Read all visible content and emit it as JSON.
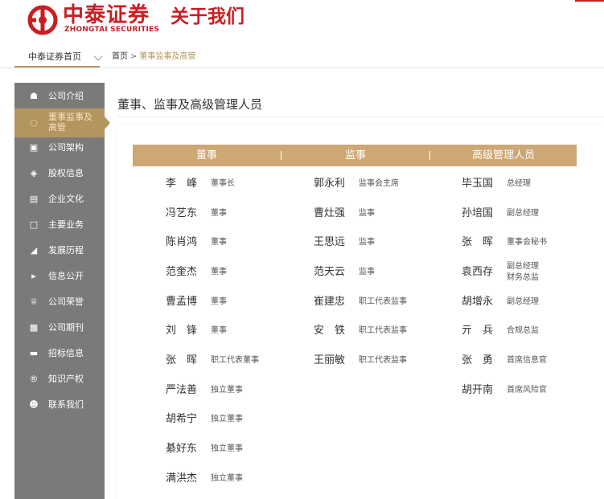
{
  "brand": {
    "name_cn": "中泰证券",
    "name_en": "ZHONGTAI SECURITIES",
    "color": "#c81e24"
  },
  "page_heading": "关于我们",
  "nav": {
    "home_label": "中泰证券首页",
    "breadcrumb": [
      "首页",
      "董事监事及高管"
    ],
    "breadcrumb_sep": ">"
  },
  "sidebar": {
    "items": [
      {
        "label": "公司介绍",
        "icon": "home-icon"
      },
      {
        "label": "董事监事及高管",
        "icon": "user-circle-icon",
        "active": true
      },
      {
        "label": "公司架构",
        "icon": "org-chart-icon"
      },
      {
        "label": "股权信息",
        "icon": "stock-icon"
      },
      {
        "label": "企业文化",
        "icon": "culture-icon"
      },
      {
        "label": "主要业务",
        "icon": "document-icon"
      },
      {
        "label": "发展历程",
        "icon": "history-icon"
      },
      {
        "label": "信息公开",
        "icon": "broadcast-icon"
      },
      {
        "label": "公司荣誉",
        "icon": "crown-icon"
      },
      {
        "label": "公司期刊",
        "icon": "journal-icon"
      },
      {
        "label": "招标信息",
        "icon": "tender-icon"
      },
      {
        "label": "知识产权",
        "icon": "registered-icon"
      },
      {
        "label": "联系我们",
        "icon": "contacts-icon"
      }
    ],
    "bg_color": "#7a7a7a",
    "active_color": "#b3955f"
  },
  "content": {
    "title": "董事、监事及高级管理人员",
    "columns": [
      "董事",
      "监事",
      "高级管理人员"
    ],
    "header_color": "#cda875",
    "directors": [
      {
        "name": "李　峰",
        "role": "董事长"
      },
      {
        "name": "冯艺东",
        "role": "董事"
      },
      {
        "name": "陈肖鸿",
        "role": "董事"
      },
      {
        "name": "范奎杰",
        "role": "董事"
      },
      {
        "name": "曹孟博",
        "role": "董事"
      },
      {
        "name": "刘　锋",
        "role": "董事"
      },
      {
        "name": "张　晖",
        "role": "职工代表董事"
      },
      {
        "name": "严法善",
        "role": "独立董事"
      },
      {
        "name": "胡希宁",
        "role": "独立董事"
      },
      {
        "name": "綦好东",
        "role": "独立董事"
      },
      {
        "name": "满洪杰",
        "role": "独立董事"
      }
    ],
    "supervisors": [
      {
        "name": "郭永利",
        "role": "监事会主席"
      },
      {
        "name": "曹灶强",
        "role": "监事"
      },
      {
        "name": "王思远",
        "role": "监事"
      },
      {
        "name": "范天云",
        "role": "监事"
      },
      {
        "name": "崔建忠",
        "role": "职工代表监事"
      },
      {
        "name": "安　铁",
        "role": "职工代表监事"
      },
      {
        "name": "王丽敏",
        "role": "职工代表监事"
      }
    ],
    "executives": [
      {
        "name": "毕玉国",
        "role": "总经理"
      },
      {
        "name": "孙培国",
        "role": "副总经理"
      },
      {
        "name": "张　晖",
        "role": "董事会秘书"
      },
      {
        "name": "袁西存",
        "role": "副总经理",
        "role2": "财务总监"
      },
      {
        "name": "胡增永",
        "role": "副总经理"
      },
      {
        "name": "亓　兵",
        "role": "合规总监"
      },
      {
        "name": "张　勇",
        "role": "首席信息官"
      },
      {
        "name": "胡开南",
        "role": "首席风险官"
      }
    ]
  }
}
